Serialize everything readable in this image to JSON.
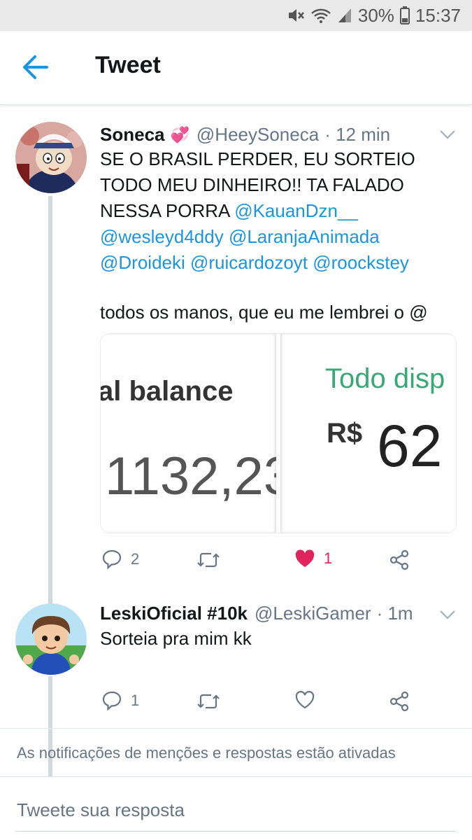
{
  "status_bar": {
    "battery": "30%",
    "time": "15:37",
    "icons": [
      "mute-icon",
      "wifi-icon",
      "signal-icon",
      "battery-icon"
    ]
  },
  "header": {
    "title": "Tweet",
    "back_icon": "arrow-left-icon"
  },
  "tweets": [
    {
      "name": "Soneca",
      "emoji": "💞",
      "handle": "@HeeySoneca",
      "time": "· 12 min",
      "text_plain_1": "SE O BRASIL PERDER, EU SORTEIO TODO MEU DINHEIRO!! TA FALADO NESSA PORRA ",
      "mentions": [
        "@KauanDzn__",
        "@wesleyd4ddy",
        "@LaranjaAnimada",
        "@Droideki",
        "@ruicardozoyt",
        "@roockstey"
      ],
      "text_plain_2": "todos os manos, que eu me lembrei o @",
      "media": {
        "left_label": "al balance",
        "left_value": "1132,23",
        "right_label": "Todo disp",
        "right_currency": "R$",
        "right_value": "62"
      },
      "replies": "2",
      "likes": "1",
      "liked": true
    },
    {
      "name": "LeskiOficial #10k",
      "handle": "@LeskiGamer",
      "time": "· 1m",
      "text": "Sorteia pra mim kk",
      "replies": "1",
      "likes": "",
      "liked": false
    }
  ],
  "notice": "As notificações de menções e respostas estão ativadas",
  "reply_placeholder": "Tweete sua resposta",
  "colors": {
    "accent": "#1b95e0",
    "like": "#e0245e",
    "muted": "#657786"
  }
}
